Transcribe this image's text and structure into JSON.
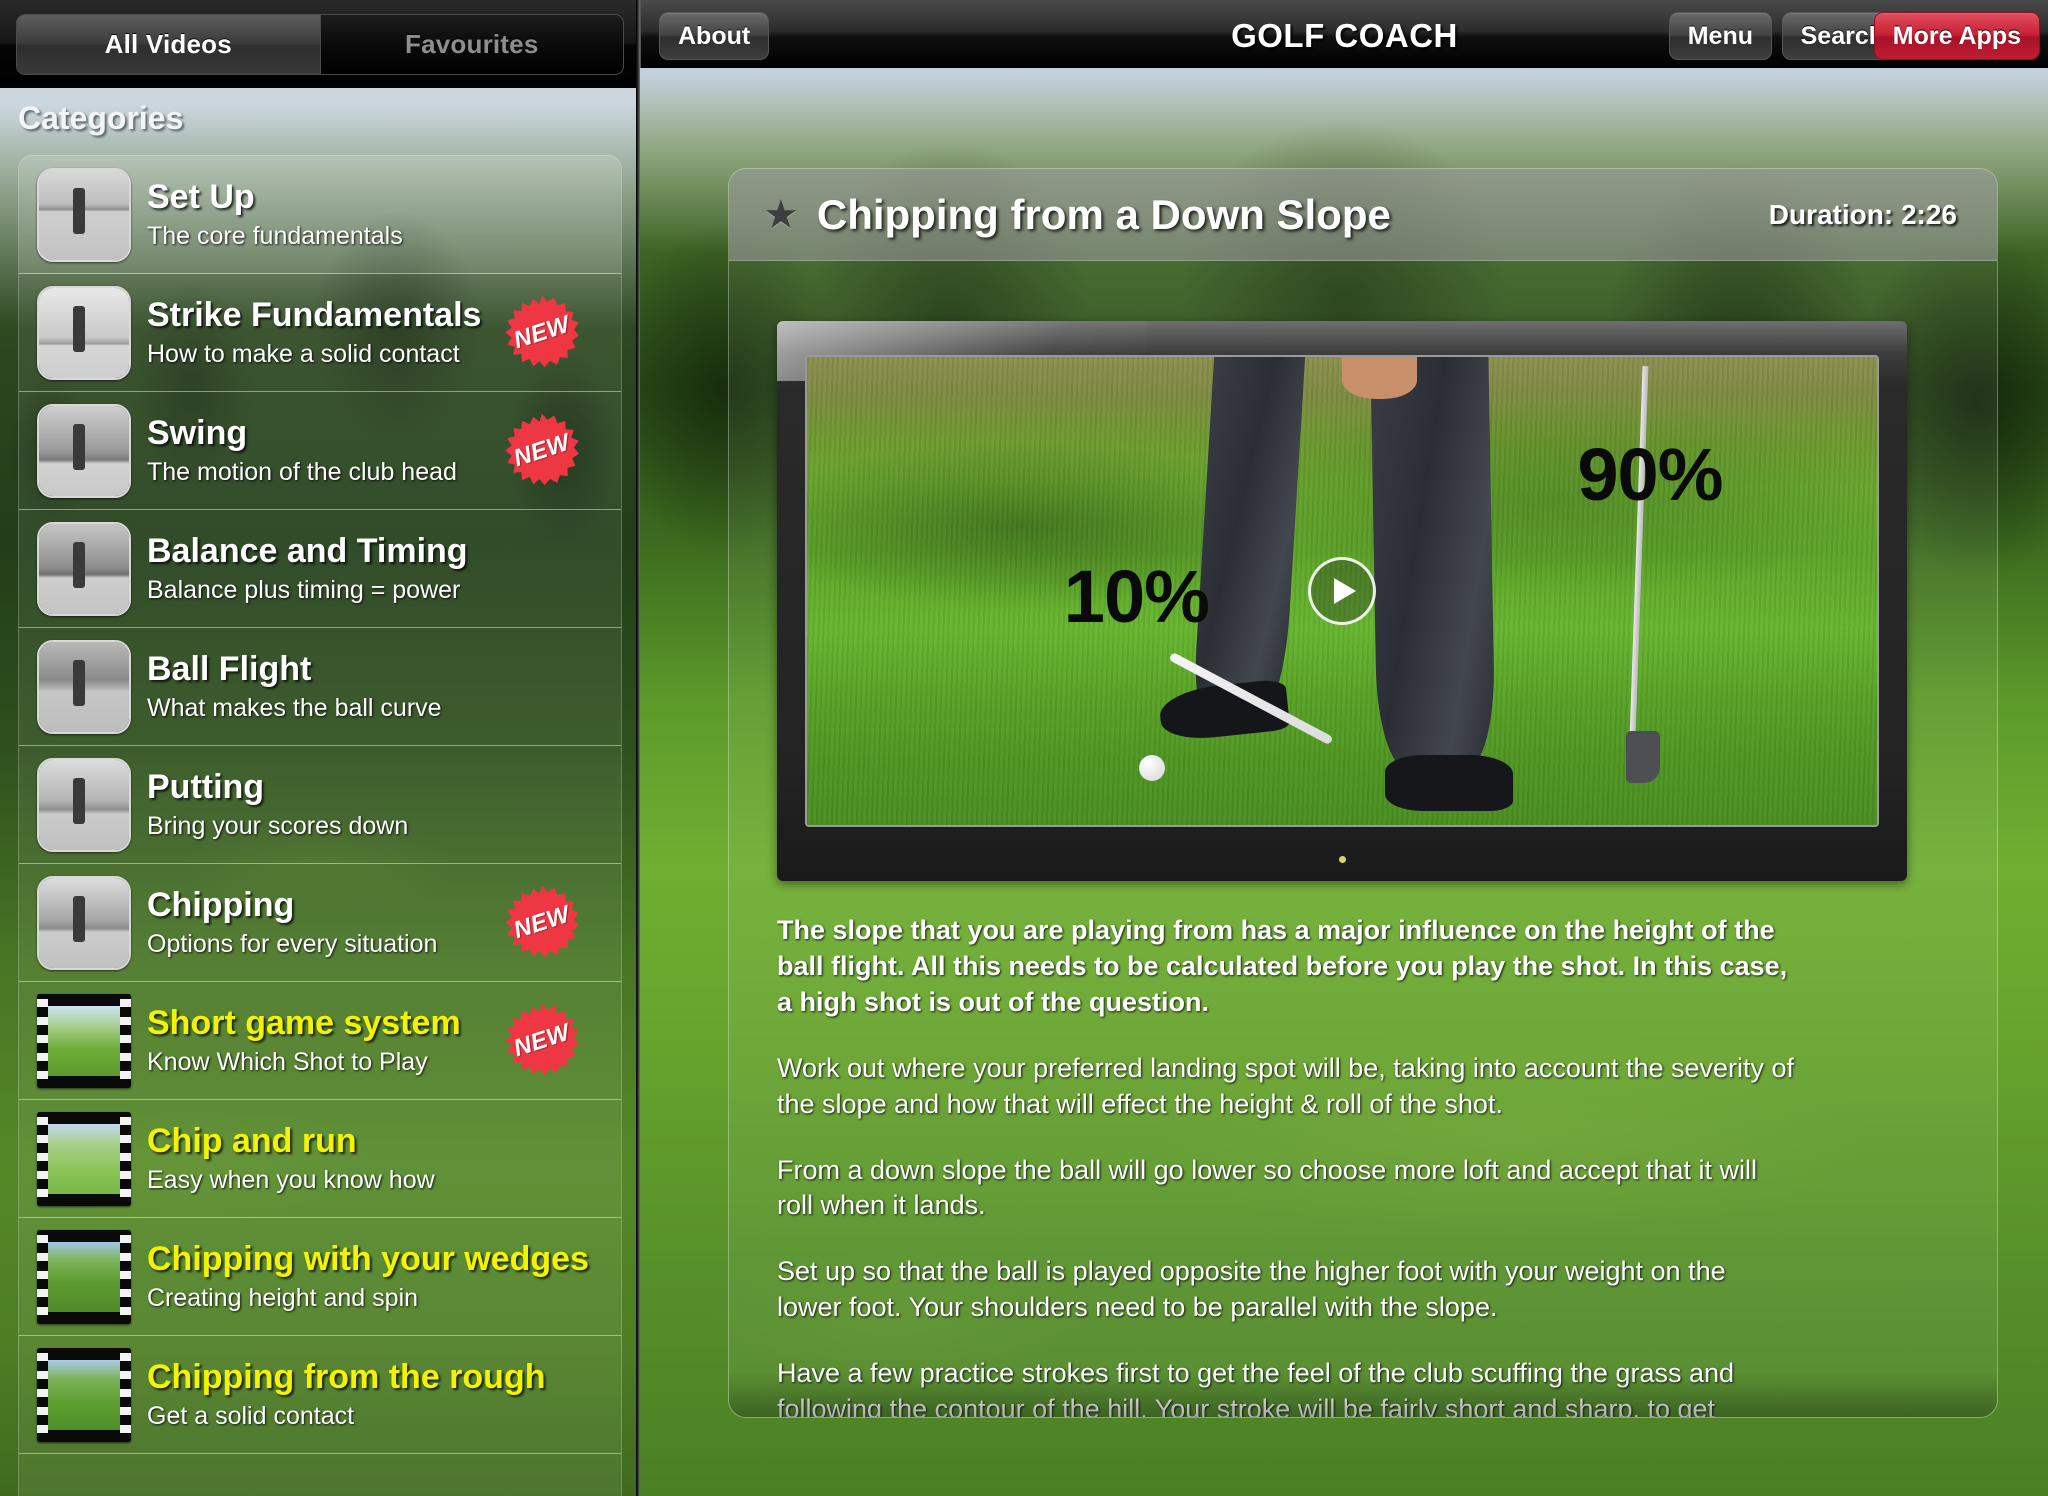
{
  "tabbar": {
    "tabs": [
      {
        "label": "All Videos",
        "active": true
      },
      {
        "label": "Favourites",
        "active": false
      }
    ]
  },
  "sidebar": {
    "heading": "Categories",
    "items": [
      {
        "title": "Set Up",
        "subtitle": "The core fundamentals",
        "highlight": false,
        "badge": "",
        "thumb": "bw",
        "selected": true
      },
      {
        "title": "Strike Fundamentals",
        "subtitle": "How to make a solid contact",
        "highlight": false,
        "badge": "NEW",
        "thumb": "bw",
        "selected": false
      },
      {
        "title": "Swing",
        "subtitle": "The motion of the club head",
        "highlight": false,
        "badge": "NEW",
        "thumb": "bw",
        "selected": false
      },
      {
        "title": "Balance and Timing",
        "subtitle": "Balance plus timing = power",
        "highlight": false,
        "badge": "",
        "thumb": "bw",
        "selected": false
      },
      {
        "title": "Ball Flight",
        "subtitle": "What makes the ball curve",
        "highlight": false,
        "badge": "",
        "thumb": "bw",
        "selected": false
      },
      {
        "title": "Putting",
        "subtitle": "Bring your scores down",
        "highlight": false,
        "badge": "",
        "thumb": "bw",
        "selected": false
      },
      {
        "title": "Chipping",
        "subtitle": "Options for every situation",
        "highlight": false,
        "badge": "NEW",
        "thumb": "bw",
        "selected": false
      },
      {
        "title": "Short game system",
        "subtitle": "Know Which Shot to Play",
        "highlight": true,
        "badge": "NEW",
        "thumb": "film",
        "selected": false
      },
      {
        "title": "Chip and run",
        "subtitle": "Easy when you know how",
        "highlight": true,
        "badge": "",
        "thumb": "film",
        "selected": false
      },
      {
        "title": "Chipping with your wedges",
        "subtitle": "Creating height and spin",
        "highlight": true,
        "badge": "",
        "thumb": "film",
        "selected": false
      },
      {
        "title": "Chipping from the rough",
        "subtitle": "Get a solid contact",
        "highlight": true,
        "badge": "",
        "thumb": "film",
        "selected": false
      }
    ]
  },
  "navbar": {
    "about_label": "About",
    "app_title": "GOLF COACH",
    "menu_label": "Menu",
    "search_label": "Search",
    "more_apps_label": "More Apps",
    "more_apps_color": "#c81f34"
  },
  "content": {
    "favourite_icon": "★",
    "video_title": "Chipping from a Down Slope",
    "duration_label": "Duration: 2:26",
    "player": {
      "play_icon": "play-icon",
      "overlay_left_percent": "10%",
      "overlay_right_percent": "90%"
    },
    "paragraphs": [
      "The slope that you are playing from has a major influence on the height of the ball flight. All this needs to be calculated before you play the shot. In this case, a high shot is out of the question.",
      "Work out where your preferred landing spot will be, taking into account the severity of the slope and how that will effect the height & roll of the shot.",
      "From a down slope the ball will go lower so choose more loft and accept that it will roll when it lands.",
      "Set up so that the ball is played opposite the higher foot with your weight on the lower foot. Your shoulders need to be parallel with the slope.",
      "Have a few practice strokes first to get the feel of the club scuffing the grass and following the contour of the hill. Your stroke will be fairly short and sharp, to get"
    ]
  }
}
